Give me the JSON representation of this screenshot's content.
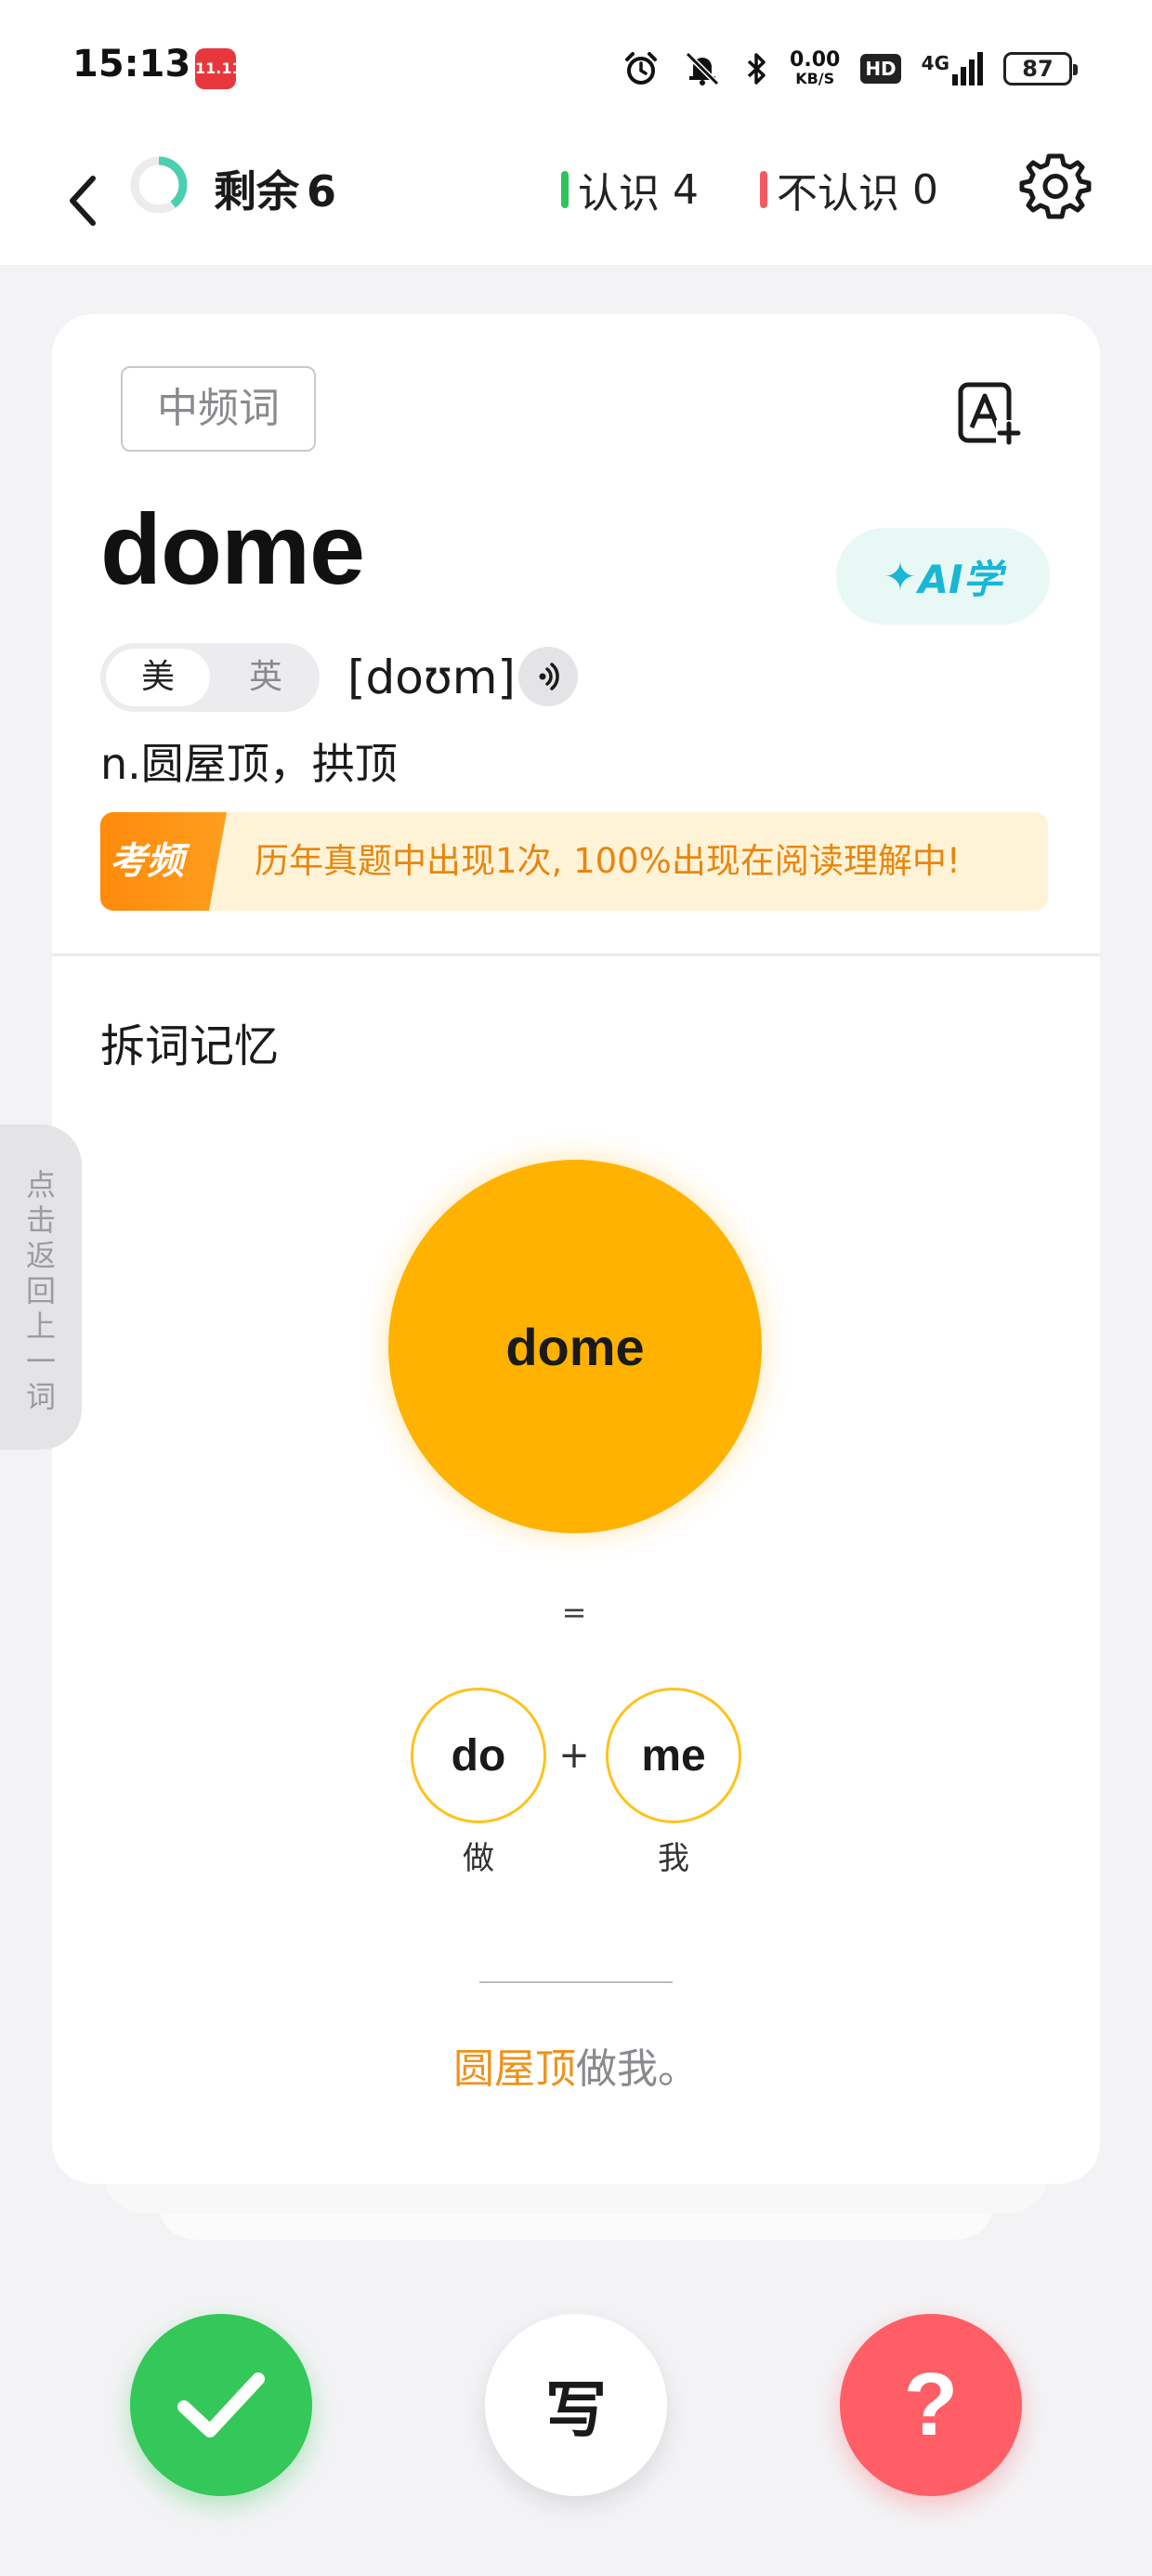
{
  "status_bar": {
    "time": "15:13",
    "app_icon": "11.11",
    "net_speed_value": "0.00",
    "net_speed_unit": "KB/S",
    "hd": "HD",
    "network": "4G",
    "battery": "87"
  },
  "header": {
    "remaining_label": "剩余",
    "remaining_count": "6",
    "known_label": "认识",
    "known_count": "4",
    "unknown_label": "不认识",
    "unknown_count": "0",
    "progress_fraction": 0.4
  },
  "card": {
    "frequency_tag": "中频词",
    "word": "dome",
    "ai_button": "AI学",
    "accent_us": "美",
    "accent_uk": "英",
    "selected_accent": "美",
    "phonetic": "[doʊm]",
    "definition": "n.圆屋顶，拱顶",
    "exam_label": "考频",
    "exam_text": "历年真题中出现1次, 100%出现在阅读理解中!",
    "section_title": "拆词记忆",
    "decomposition": {
      "whole": "dome",
      "equals": "=",
      "plus": "+",
      "parts": [
        {
          "text": "do",
          "meaning": "做"
        },
        {
          "text": "me",
          "meaning": "我"
        }
      ],
      "mnemonic_highlight": "圆屋顶",
      "mnemonic_rest": "做我。"
    }
  },
  "side_tab": {
    "label": "点击返回上一词"
  },
  "bottom_actions": {
    "write_label": "写",
    "unknown_symbol": "?"
  },
  "colors": {
    "known_green": "#34c759",
    "unknown_red": "#ff5e66",
    "accent_orange": "#ffb300",
    "exam_orange": "#e8860f"
  }
}
